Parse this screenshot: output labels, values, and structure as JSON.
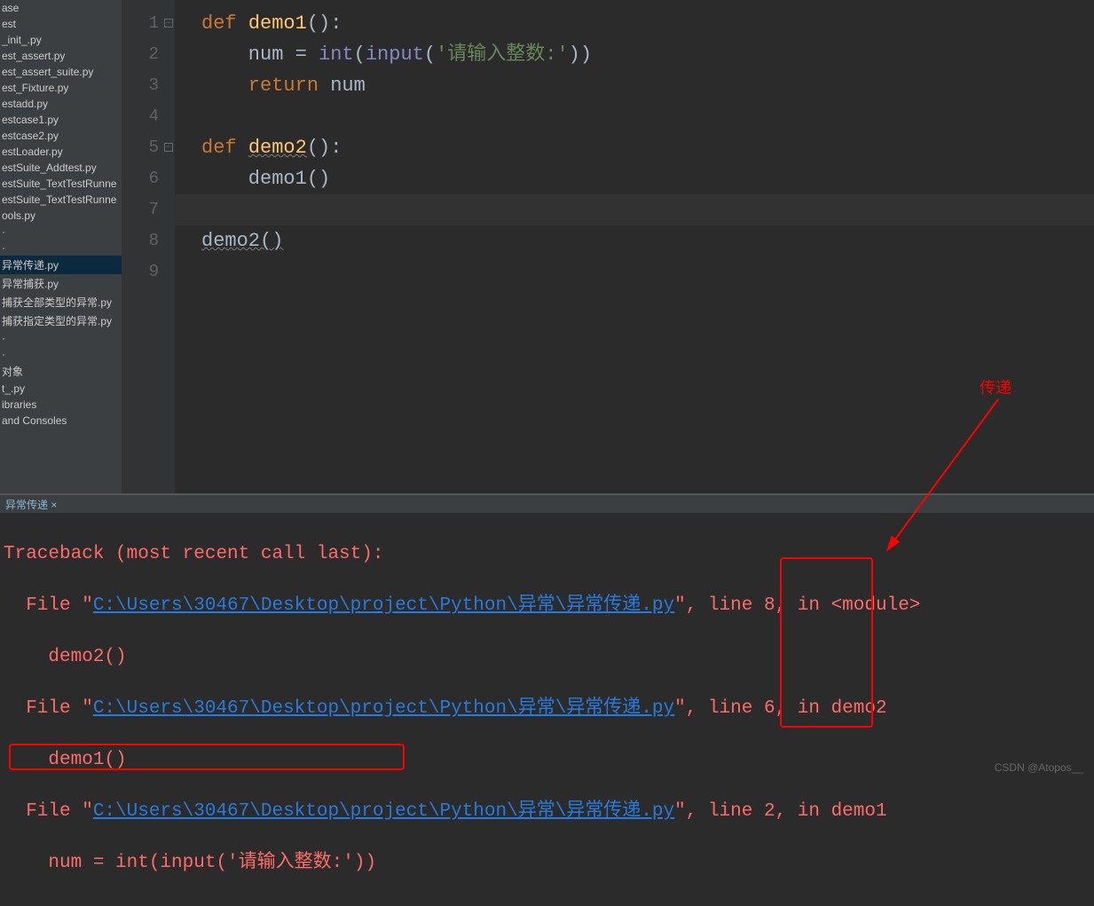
{
  "sidebar": {
    "items": [
      "ase",
      "est",
      "_init_.py",
      "est_assert.py",
      "est_assert_suite.py",
      "est_Fixture.py",
      "estadd.py",
      "estcase1.py",
      "estcase2.py",
      "estLoader.py",
      "estSuite_Addtest.py",
      "estSuite_TextTestRunne",
      "estSuite_TextTestRunne",
      "ools.py",
      "·",
      "·",
      "异常传递.py",
      "异常捕获.py",
      "捕获全部类型的异常.py",
      "捕获指定类型的异常.py",
      "·",
      "·",
      "对象",
      "t_.py",
      "ibraries",
      "and Consoles"
    ],
    "selected_index": 16
  },
  "editor": {
    "lines": {
      "l1_def": "def",
      "l1_name": "demo1",
      "l1_rest": "():",
      "l2a": "    num = ",
      "l2_int": "int",
      "l2b": "(",
      "l2_input": "input",
      "l2c": "(",
      "l2_str": "'请输入整数:'",
      "l2d": "))",
      "l3_ret": "    return",
      "l3_var": " num",
      "l5_def": "def",
      "l5_name": "demo2",
      "l5_rest": "():",
      "l6": "    demo1()",
      "l8": "demo2()"
    },
    "linenos": [
      "1",
      "2",
      "3",
      "4",
      "5",
      "6",
      "7",
      "8",
      "9"
    ]
  },
  "panel": {
    "tab_label": "异常传递 ×"
  },
  "console": {
    "tb_header": "Traceback (most recent call last):",
    "file_word": "  File ",
    "quote": "\"",
    "path": "C:\\Users\\30467\\Desktop\\project\\Python\\异常\\异常传递.py",
    "comma": ", ",
    "l8": "line 8,",
    "in_mod": " in <module>",
    "call2": "    demo2()",
    "l6": "line 6,",
    "in_d2": " in demo2",
    "call1": "    demo1()",
    "l2": "line 2,",
    "in_d1": " in demo1",
    "src": "    num = int(input('请输入整数:'))"
  },
  "annotation": {
    "label": "传递"
  },
  "watermark": "CSDN @Atopos__"
}
